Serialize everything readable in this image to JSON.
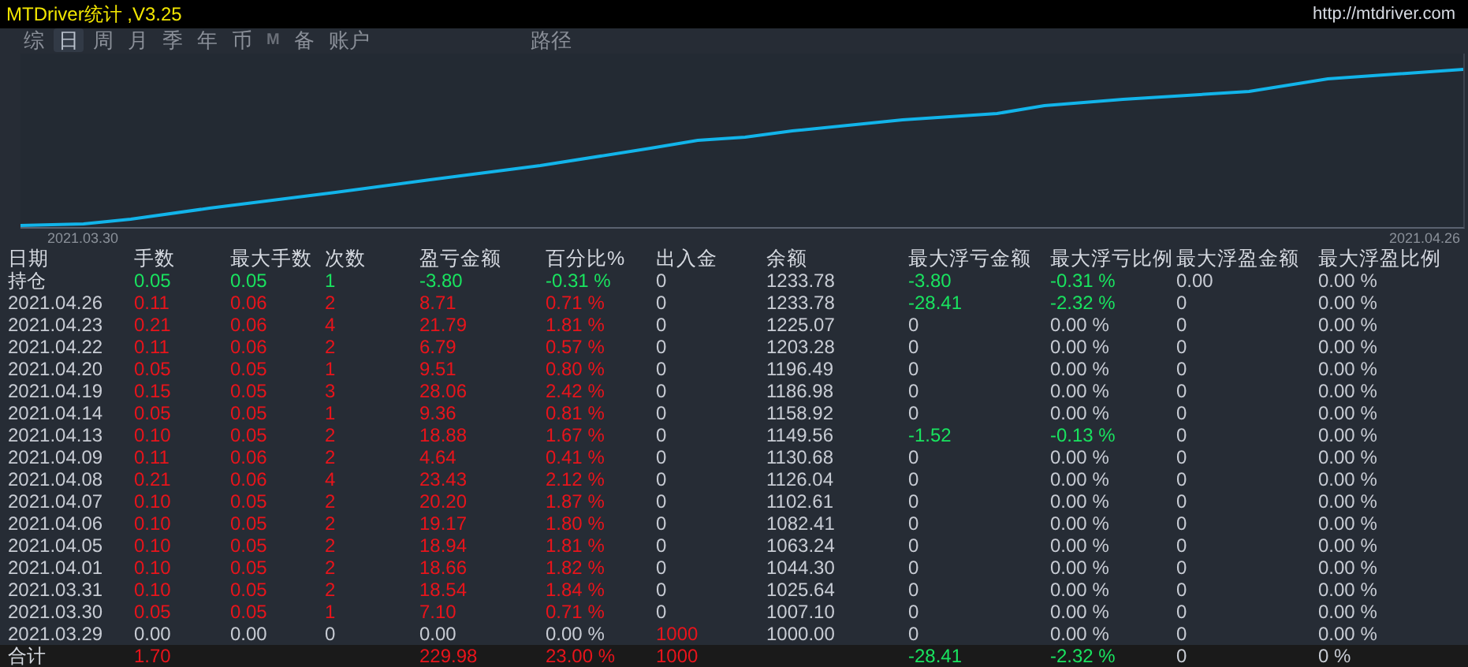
{
  "window": {
    "title": "MTDriver统计 ,V3.25",
    "link": "http://mtdriver.com"
  },
  "tabs": [
    {
      "label": "综",
      "selected": false
    },
    {
      "label": "日",
      "selected": true
    },
    {
      "label": "周",
      "selected": false
    },
    {
      "label": "月",
      "selected": false
    },
    {
      "label": "季",
      "selected": false
    },
    {
      "label": "年",
      "selected": false
    },
    {
      "label": "币",
      "selected": false
    },
    {
      "label": "M",
      "selected": false
    },
    {
      "label": "备",
      "selected": false
    },
    {
      "label": "账户",
      "selected": false
    }
  ],
  "path_tab": {
    "label": "路径",
    "selected": false
  },
  "chart": {
    "start_label": "2021.03.30",
    "end_label": "2021.04.26"
  },
  "table": {
    "columns": [
      "日期",
      "手数",
      "最大手数",
      "次数",
      "盈亏金额",
      "百分比%",
      "出入金",
      "余额",
      "最大浮亏金额",
      "最大浮亏比例",
      "最大浮盈金额",
      "最大浮盈比例"
    ],
    "rows": [
      {
        "kind": "open",
        "cells": [
          {
            "v": "持仓"
          },
          {
            "v": "0.05",
            "color": "#19e35f"
          },
          {
            "v": "0.05",
            "color": "#19e35f"
          },
          {
            "v": "1",
            "color": "#19e35f"
          },
          {
            "v": "-3.80",
            "color": "#19e35f"
          },
          {
            "v": "-0.31 %",
            "color": "#19e35f"
          },
          {
            "v": "0"
          },
          {
            "v": "1233.78"
          },
          {
            "v": "-3.80",
            "color": "#19e35f"
          },
          {
            "v": "-0.31 %",
            "color": "#19e35f"
          },
          {
            "v": "0.00"
          },
          {
            "v": "0.00 %"
          }
        ]
      },
      {
        "kind": "day",
        "cells": [
          {
            "v": "2021.04.26"
          },
          {
            "v": "0.11",
            "color": "#e8141b"
          },
          {
            "v": "0.06",
            "color": "#e8141b"
          },
          {
            "v": "2",
            "color": "#e8141b"
          },
          {
            "v": "8.71",
            "color": "#e8141b"
          },
          {
            "v": "0.71 %",
            "color": "#e8141b"
          },
          {
            "v": "0"
          },
          {
            "v": "1233.78"
          },
          {
            "v": "-28.41",
            "color": "#19e35f"
          },
          {
            "v": "-2.32 %",
            "color": "#19e35f"
          },
          {
            "v": "0"
          },
          {
            "v": "0.00 %"
          }
        ]
      },
      {
        "kind": "day",
        "cells": [
          {
            "v": "2021.04.23"
          },
          {
            "v": "0.21",
            "color": "#e8141b"
          },
          {
            "v": "0.06",
            "color": "#e8141b"
          },
          {
            "v": "4",
            "color": "#e8141b"
          },
          {
            "v": "21.79",
            "color": "#e8141b"
          },
          {
            "v": "1.81 %",
            "color": "#e8141b"
          },
          {
            "v": "0"
          },
          {
            "v": "1225.07"
          },
          {
            "v": "0"
          },
          {
            "v": "0.00 %"
          },
          {
            "v": "0"
          },
          {
            "v": "0.00 %"
          }
        ]
      },
      {
        "kind": "day",
        "cells": [
          {
            "v": "2021.04.22"
          },
          {
            "v": "0.11",
            "color": "#e8141b"
          },
          {
            "v": "0.06",
            "color": "#e8141b"
          },
          {
            "v": "2",
            "color": "#e8141b"
          },
          {
            "v": "6.79",
            "color": "#e8141b"
          },
          {
            "v": "0.57 %",
            "color": "#e8141b"
          },
          {
            "v": "0"
          },
          {
            "v": "1203.28"
          },
          {
            "v": "0"
          },
          {
            "v": "0.00 %"
          },
          {
            "v": "0"
          },
          {
            "v": "0.00 %"
          }
        ]
      },
      {
        "kind": "day",
        "cells": [
          {
            "v": "2021.04.20"
          },
          {
            "v": "0.05",
            "color": "#e8141b"
          },
          {
            "v": "0.05",
            "color": "#e8141b"
          },
          {
            "v": "1",
            "color": "#e8141b"
          },
          {
            "v": "9.51",
            "color": "#e8141b"
          },
          {
            "v": "0.80 %",
            "color": "#e8141b"
          },
          {
            "v": "0"
          },
          {
            "v": "1196.49"
          },
          {
            "v": "0"
          },
          {
            "v": "0.00 %"
          },
          {
            "v": "0"
          },
          {
            "v": "0.00 %"
          }
        ]
      },
      {
        "kind": "day",
        "cells": [
          {
            "v": "2021.04.19"
          },
          {
            "v": "0.15",
            "color": "#e8141b"
          },
          {
            "v": "0.05",
            "color": "#e8141b"
          },
          {
            "v": "3",
            "color": "#e8141b"
          },
          {
            "v": "28.06",
            "color": "#e8141b"
          },
          {
            "v": "2.42 %",
            "color": "#e8141b"
          },
          {
            "v": "0"
          },
          {
            "v": "1186.98"
          },
          {
            "v": "0"
          },
          {
            "v": "0.00 %"
          },
          {
            "v": "0"
          },
          {
            "v": "0.00 %"
          }
        ]
      },
      {
        "kind": "day",
        "cells": [
          {
            "v": "2021.04.14"
          },
          {
            "v": "0.05",
            "color": "#e8141b"
          },
          {
            "v": "0.05",
            "color": "#e8141b"
          },
          {
            "v": "1",
            "color": "#e8141b"
          },
          {
            "v": "9.36",
            "color": "#e8141b"
          },
          {
            "v": "0.81 %",
            "color": "#e8141b"
          },
          {
            "v": "0"
          },
          {
            "v": "1158.92"
          },
          {
            "v": "0"
          },
          {
            "v": "0.00 %"
          },
          {
            "v": "0"
          },
          {
            "v": "0.00 %"
          }
        ]
      },
      {
        "kind": "day",
        "cells": [
          {
            "v": "2021.04.13"
          },
          {
            "v": "0.10",
            "color": "#e8141b"
          },
          {
            "v": "0.05",
            "color": "#e8141b"
          },
          {
            "v": "2",
            "color": "#e8141b"
          },
          {
            "v": "18.88",
            "color": "#e8141b"
          },
          {
            "v": "1.67 %",
            "color": "#e8141b"
          },
          {
            "v": "0"
          },
          {
            "v": "1149.56"
          },
          {
            "v": "-1.52",
            "color": "#19e35f"
          },
          {
            "v": "-0.13 %",
            "color": "#19e35f"
          },
          {
            "v": "0"
          },
          {
            "v": "0.00 %"
          }
        ]
      },
      {
        "kind": "day",
        "cells": [
          {
            "v": "2021.04.09"
          },
          {
            "v": "0.11",
            "color": "#e8141b"
          },
          {
            "v": "0.06",
            "color": "#e8141b"
          },
          {
            "v": "2",
            "color": "#e8141b"
          },
          {
            "v": "4.64",
            "color": "#e8141b"
          },
          {
            "v": "0.41 %",
            "color": "#e8141b"
          },
          {
            "v": "0"
          },
          {
            "v": "1130.68"
          },
          {
            "v": "0"
          },
          {
            "v": "0.00 %"
          },
          {
            "v": "0"
          },
          {
            "v": "0.00 %"
          }
        ]
      },
      {
        "kind": "day",
        "cells": [
          {
            "v": "2021.04.08"
          },
          {
            "v": "0.21",
            "color": "#e8141b"
          },
          {
            "v": "0.06",
            "color": "#e8141b"
          },
          {
            "v": "4",
            "color": "#e8141b"
          },
          {
            "v": "23.43",
            "color": "#e8141b"
          },
          {
            "v": "2.12 %",
            "color": "#e8141b"
          },
          {
            "v": "0"
          },
          {
            "v": "1126.04"
          },
          {
            "v": "0"
          },
          {
            "v": "0.00 %"
          },
          {
            "v": "0"
          },
          {
            "v": "0.00 %"
          }
        ]
      },
      {
        "kind": "day",
        "cells": [
          {
            "v": "2021.04.07"
          },
          {
            "v": "0.10",
            "color": "#e8141b"
          },
          {
            "v": "0.05",
            "color": "#e8141b"
          },
          {
            "v": "2",
            "color": "#e8141b"
          },
          {
            "v": "20.20",
            "color": "#e8141b"
          },
          {
            "v": "1.87 %",
            "color": "#e8141b"
          },
          {
            "v": "0"
          },
          {
            "v": "1102.61"
          },
          {
            "v": "0"
          },
          {
            "v": "0.00 %"
          },
          {
            "v": "0"
          },
          {
            "v": "0.00 %"
          }
        ]
      },
      {
        "kind": "day",
        "cells": [
          {
            "v": "2021.04.06"
          },
          {
            "v": "0.10",
            "color": "#e8141b"
          },
          {
            "v": "0.05",
            "color": "#e8141b"
          },
          {
            "v": "2",
            "color": "#e8141b"
          },
          {
            "v": "19.17",
            "color": "#e8141b"
          },
          {
            "v": "1.80 %",
            "color": "#e8141b"
          },
          {
            "v": "0"
          },
          {
            "v": "1082.41"
          },
          {
            "v": "0"
          },
          {
            "v": "0.00 %"
          },
          {
            "v": "0"
          },
          {
            "v": "0.00 %"
          }
        ]
      },
      {
        "kind": "day",
        "cells": [
          {
            "v": "2021.04.05"
          },
          {
            "v": "0.10",
            "color": "#e8141b"
          },
          {
            "v": "0.05",
            "color": "#e8141b"
          },
          {
            "v": "2",
            "color": "#e8141b"
          },
          {
            "v": "18.94",
            "color": "#e8141b"
          },
          {
            "v": "1.81 %",
            "color": "#e8141b"
          },
          {
            "v": "0"
          },
          {
            "v": "1063.24"
          },
          {
            "v": "0"
          },
          {
            "v": "0.00 %"
          },
          {
            "v": "0"
          },
          {
            "v": "0.00 %"
          }
        ]
      },
      {
        "kind": "day",
        "cells": [
          {
            "v": "2021.04.01"
          },
          {
            "v": "0.10",
            "color": "#e8141b"
          },
          {
            "v": "0.05",
            "color": "#e8141b"
          },
          {
            "v": "2",
            "color": "#e8141b"
          },
          {
            "v": "18.66",
            "color": "#e8141b"
          },
          {
            "v": "1.82 %",
            "color": "#e8141b"
          },
          {
            "v": "0"
          },
          {
            "v": "1044.30"
          },
          {
            "v": "0"
          },
          {
            "v": "0.00 %"
          },
          {
            "v": "0"
          },
          {
            "v": "0.00 %"
          }
        ]
      },
      {
        "kind": "day",
        "cells": [
          {
            "v": "2021.03.31"
          },
          {
            "v": "0.10",
            "color": "#e8141b"
          },
          {
            "v": "0.05",
            "color": "#e8141b"
          },
          {
            "v": "2",
            "color": "#e8141b"
          },
          {
            "v": "18.54",
            "color": "#e8141b"
          },
          {
            "v": "1.84 %",
            "color": "#e8141b"
          },
          {
            "v": "0"
          },
          {
            "v": "1025.64"
          },
          {
            "v": "0"
          },
          {
            "v": "0.00 %"
          },
          {
            "v": "0"
          },
          {
            "v": "0.00 %"
          }
        ]
      },
      {
        "kind": "day",
        "cells": [
          {
            "v": "2021.03.30"
          },
          {
            "v": "0.05",
            "color": "#e8141b"
          },
          {
            "v": "0.05",
            "color": "#e8141b"
          },
          {
            "v": "1",
            "color": "#e8141b"
          },
          {
            "v": "7.10",
            "color": "#e8141b"
          },
          {
            "v": "0.71 %",
            "color": "#e8141b"
          },
          {
            "v": "0"
          },
          {
            "v": "1007.10"
          },
          {
            "v": "0"
          },
          {
            "v": "0.00 %"
          },
          {
            "v": "0"
          },
          {
            "v": "0.00 %"
          }
        ]
      },
      {
        "kind": "day",
        "cells": [
          {
            "v": "2021.03.29"
          },
          {
            "v": "0.00"
          },
          {
            "v": "0.00"
          },
          {
            "v": "0"
          },
          {
            "v": "0.00"
          },
          {
            "v": "0.00 %"
          },
          {
            "v": "1000",
            "color": "#e8141b"
          },
          {
            "v": "1000.00"
          },
          {
            "v": "0"
          },
          {
            "v": "0.00 %"
          },
          {
            "v": "0"
          },
          {
            "v": "0.00 %"
          }
        ]
      },
      {
        "kind": "total",
        "cells": [
          {
            "v": "合计"
          },
          {
            "v": "1.70",
            "color": "#e8141b"
          },
          {},
          {},
          {
            "v": "229.98",
            "color": "#e8141b"
          },
          {
            "v": "23.00 %",
            "color": "#e8141b"
          },
          {
            "v": "1000",
            "color": "#e8141b"
          },
          {},
          {
            "v": "-28.41",
            "color": "#19e35f"
          },
          {
            "v": "-2.32 %",
            "color": "#19e35f"
          },
          {
            "v": "0"
          },
          {
            "v": "0 %"
          }
        ]
      }
    ]
  }
}
